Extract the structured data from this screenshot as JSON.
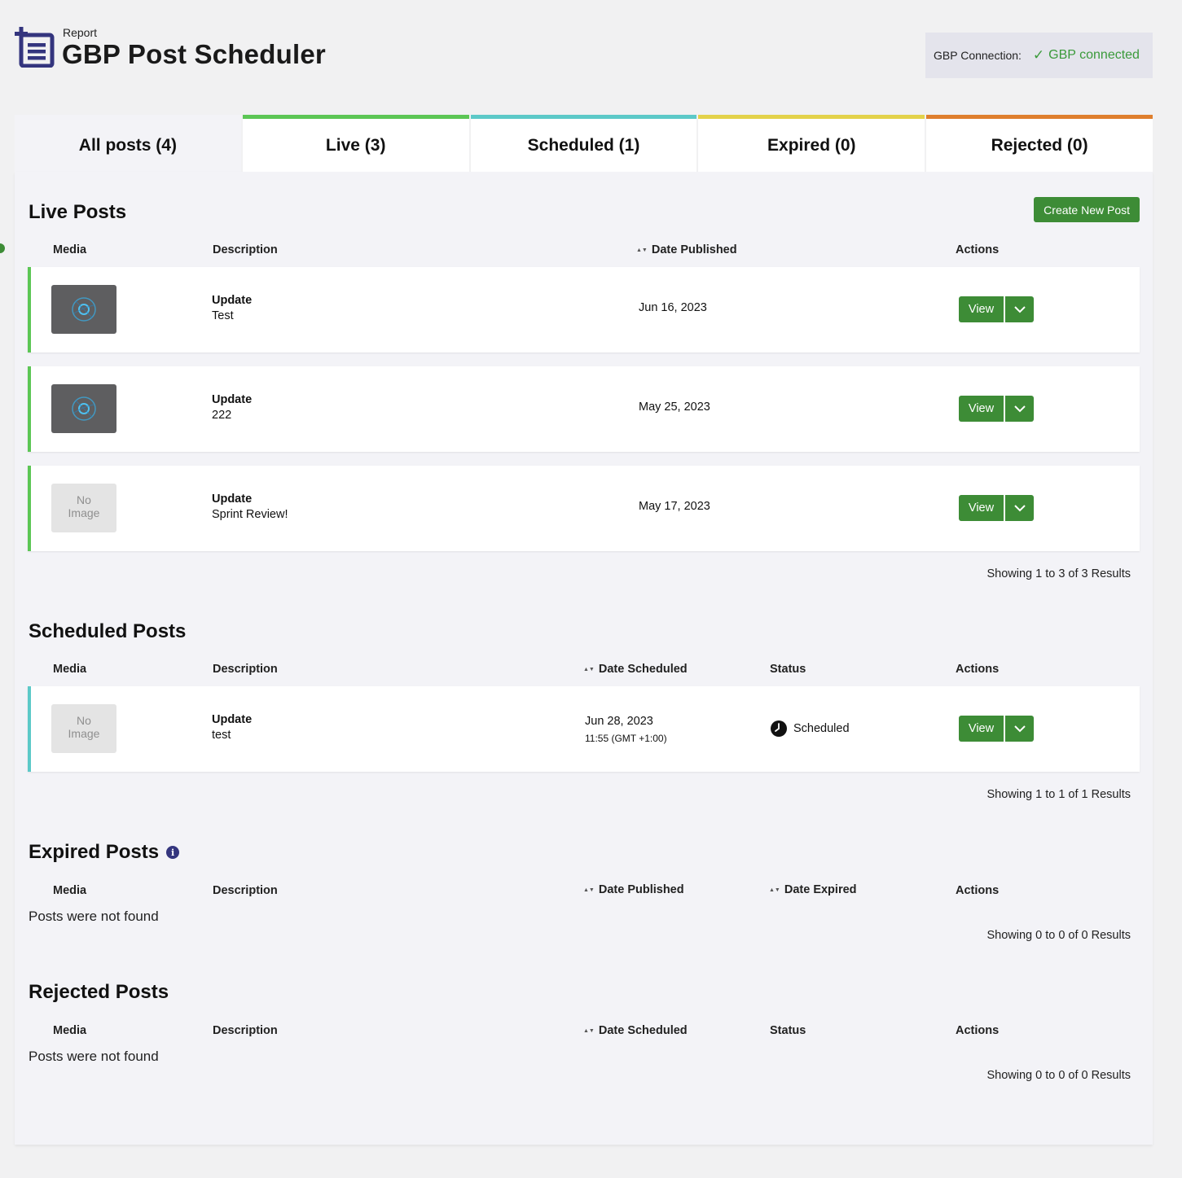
{
  "header": {
    "subtitle": "Report",
    "title": "GBP Post Scheduler",
    "connection_label": "GBP Connection:",
    "connection_value": "GBP connected",
    "connection_icon": "check-icon"
  },
  "colors": {
    "brand": "#34357e",
    "green": "#3d8c36",
    "live": "#5cc655",
    "scheduled": "#5cc9c8",
    "expired": "#e3d24a",
    "rejected": "#df7f2e"
  },
  "tabs": [
    {
      "label": "All posts (4)",
      "active": true
    },
    {
      "label": "Live (3)"
    },
    {
      "label": "Scheduled (1)"
    },
    {
      "label": "Expired (0)"
    },
    {
      "label": "Rejected (0)"
    }
  ],
  "live": {
    "title": "Live Posts",
    "create_label": "Create New Post",
    "columns": [
      "Media",
      "Description",
      "Date Published",
      "Actions"
    ],
    "rows": [
      {
        "media": "image",
        "type": "Update",
        "text": "Test",
        "date": "Jun 16, 2023"
      },
      {
        "media": "image",
        "type": "Update",
        "text": "222",
        "date": "May 25, 2023"
      },
      {
        "media": "No Image",
        "type": "Update",
        "text": "Sprint Review!",
        "date": "May 17, 2023"
      }
    ],
    "view_label": "View",
    "showing": "Showing 1 to 3 of 3 Results"
  },
  "scheduled": {
    "title": "Scheduled Posts",
    "columns": [
      "Media",
      "Description",
      "Date Scheduled",
      "Status",
      "Actions"
    ],
    "rows": [
      {
        "media": "No Image",
        "type": "Update",
        "text": "test",
        "date": "Jun 28, 2023",
        "time": "11:55 (GMT +1:00)",
        "status": "Scheduled"
      }
    ],
    "view_label": "View",
    "showing": "Showing 1 to 1 of 1 Results"
  },
  "expired": {
    "title": "Expired Posts",
    "columns": [
      "Media",
      "Description",
      "Date Published",
      "Date Expired",
      "Actions"
    ],
    "empty": "Posts were not found",
    "showing": "Showing 0 to 0 of 0 Results"
  },
  "rejected": {
    "title": "Rejected Posts",
    "columns": [
      "Media",
      "Description",
      "Date Scheduled",
      "Status",
      "Actions"
    ],
    "empty": "Posts were not found",
    "showing": "Showing 0 to 0 of 0 Results"
  },
  "no_image_lines": [
    "No",
    "Image"
  ]
}
